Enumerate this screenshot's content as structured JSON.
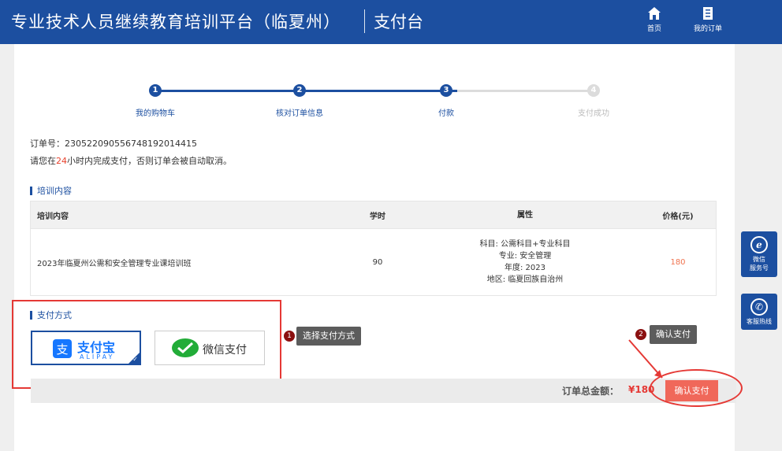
{
  "header": {
    "title": "专业技术人员继续教育培训平台（临夏州）",
    "subtitle": "支付台",
    "nav": [
      {
        "label": "首页",
        "icon": "home-icon"
      },
      {
        "label": "我的订单",
        "icon": "orders-icon"
      }
    ]
  },
  "steps": [
    {
      "num": "1",
      "label": "我的购物车",
      "state": "done"
    },
    {
      "num": "2",
      "label": "核对订单信息",
      "state": "done"
    },
    {
      "num": "3",
      "label": "付款",
      "state": "current"
    },
    {
      "num": "4",
      "label": "支付成功",
      "state": "todo"
    }
  ],
  "order": {
    "number_text": "订单号：2305220905567481920144​15",
    "tip_before": "请您在",
    "tip_hours": "24",
    "tip_after": "小时内完成支付，否则订单会被自动取消。"
  },
  "training": {
    "section_title": "培训内容",
    "columns": [
      "培训内容",
      "学时",
      "属性",
      "价格(元)"
    ],
    "row": {
      "name": "2023年临夏州公需和安全管理专业课培训班",
      "hours": "90",
      "attrs": [
        "科目: 公需科目+专业科目",
        "专业: 安全管理",
        "年度: 2023",
        "地区: 临夏回族自治州"
      ],
      "price": "180"
    }
  },
  "payment": {
    "section_title": "支付方式",
    "alipay_cn": "支付宝",
    "alipay_en": "ALIPAY",
    "wechat": "微信支付",
    "tip1_num": "1",
    "tip1": "选择支付方式",
    "tip2_num": "2",
    "tip2": "确认支付"
  },
  "total": {
    "label": "订单总金额：",
    "value": "¥180",
    "confirm": "确认支付"
  },
  "side": [
    {
      "label1": "微信",
      "label2": "服务号",
      "icon": "wechat-service-icon"
    },
    {
      "label1": "客服热线",
      "label2": "",
      "icon": "phone-icon"
    }
  ],
  "colors": {
    "brand": "#1c4fa0",
    "accent": "#e53935",
    "price": "#f0734f",
    "button": "#f0685a"
  }
}
